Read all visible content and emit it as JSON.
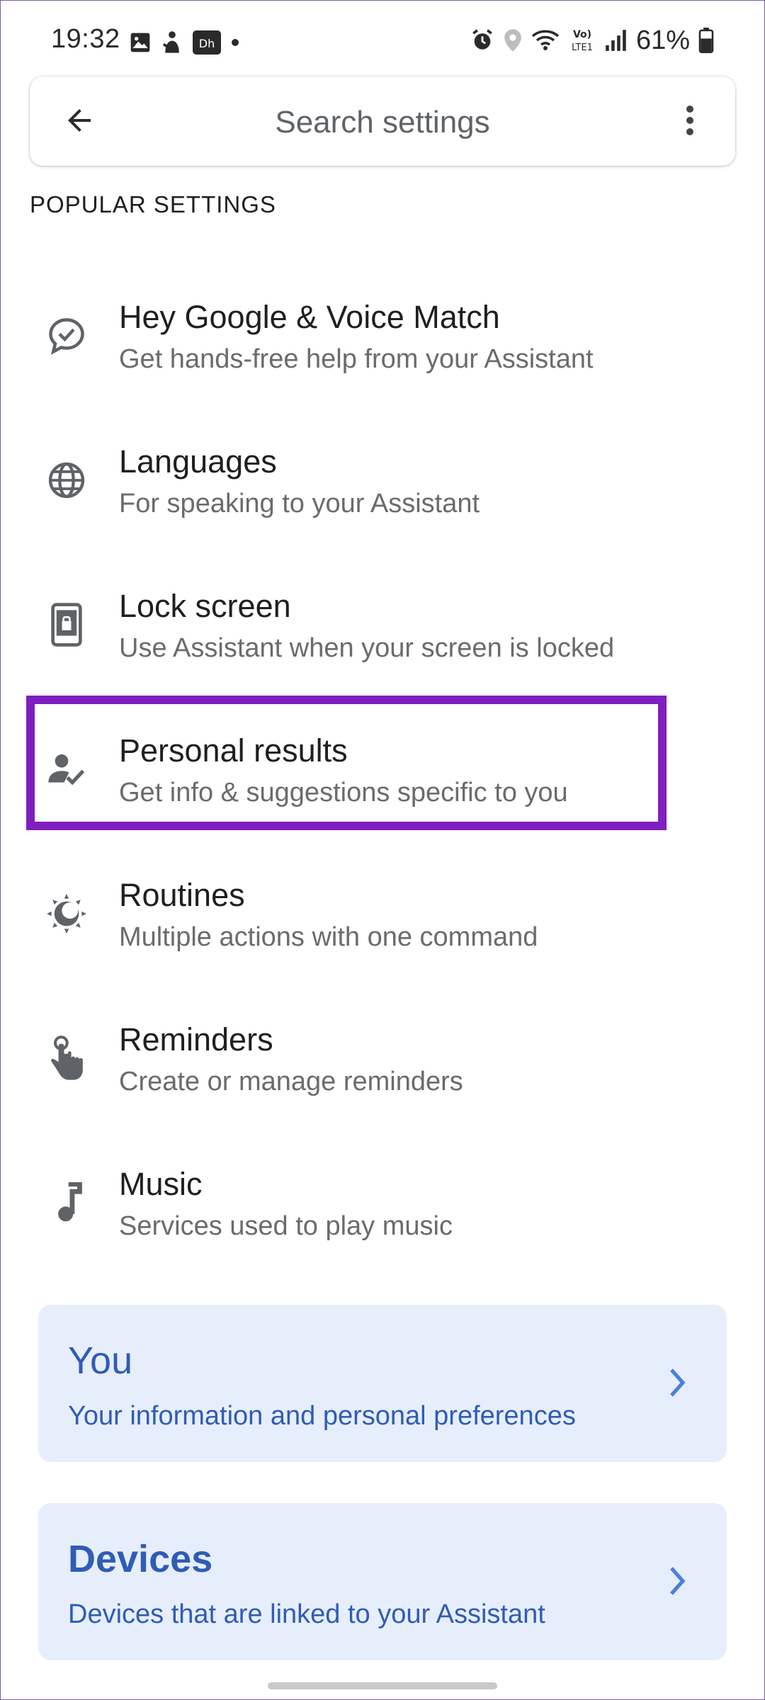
{
  "status_bar": {
    "time": "19:32",
    "left_icons": [
      "image-icon",
      "gesture-icon",
      "disney-plus-icon",
      "dot-icon"
    ],
    "disney_label": "Dh",
    "right_icons": [
      "alarm-icon",
      "location-icon",
      "wifi-icon",
      "volte-icon",
      "signal-icon",
      "battery-icon"
    ],
    "volte_top": "Vo)",
    "volte_bottom": "LTE1",
    "battery_percent": "61%"
  },
  "search": {
    "placeholder": "Search settings",
    "back_icon": "arrow-back-icon",
    "more_icon": "more-vert-icon"
  },
  "popular_settings": {
    "header": "POPULAR SETTINGS",
    "items": [
      {
        "icon": "voice-match-icon",
        "title": "Hey Google & Voice Match",
        "subtitle": "Get hands-free help from your Assistant"
      },
      {
        "icon": "globe-icon",
        "title": "Languages",
        "subtitle": "For speaking to your Assistant"
      },
      {
        "icon": "lock-screen-icon",
        "title": "Lock screen",
        "subtitle": "Use Assistant when your screen is locked"
      },
      {
        "icon": "person-check-icon",
        "title": "Personal results",
        "subtitle": "Get info & suggestions specific to you"
      },
      {
        "icon": "routines-icon",
        "title": "Routines",
        "subtitle": "Multiple actions with one command"
      },
      {
        "icon": "reminder-hand-icon",
        "title": "Reminders",
        "subtitle": "Create or manage reminders"
      },
      {
        "icon": "music-note-icon",
        "title": "Music",
        "subtitle": "Services used to play music"
      }
    ]
  },
  "cards": {
    "you": {
      "title": "You",
      "subtitle": "Your information and personal preferences"
    },
    "devices": {
      "title": "Devices",
      "subtitle": "Devices that are linked to your Assistant"
    }
  },
  "colors": {
    "highlight": "#7f1fbf",
    "card_bg": "#e7eefb",
    "card_text": "#2f5cb6"
  }
}
